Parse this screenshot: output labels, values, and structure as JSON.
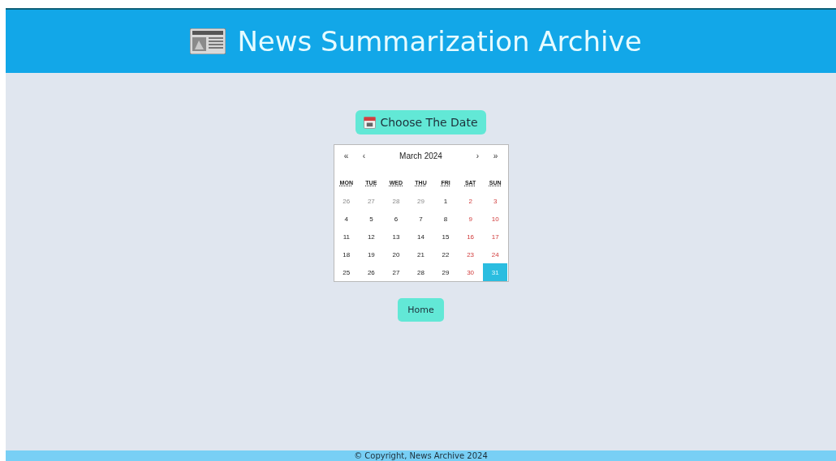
{
  "header": {
    "title": "News Summarization Archive"
  },
  "date_button": {
    "label": "Choose The Date"
  },
  "calendar": {
    "nav": [
      "«",
      "‹",
      "›",
      "»"
    ],
    "month": "March 2024",
    "weekdays": [
      "MON",
      "TUE",
      "WED",
      "THU",
      "FRI",
      "SAT",
      "SUN"
    ],
    "weeks": [
      [
        {
          "day": "26",
          "kind": "other",
          "selected": false
        },
        {
          "day": "27",
          "kind": "other",
          "selected": false
        },
        {
          "day": "28",
          "kind": "other",
          "selected": false
        },
        {
          "day": "29",
          "kind": "other",
          "selected": false
        },
        {
          "day": "1",
          "kind": "normal",
          "selected": false
        },
        {
          "day": "2",
          "kind": "weekend",
          "selected": false
        },
        {
          "day": "3",
          "kind": "weekend",
          "selected": false
        }
      ],
      [
        {
          "day": "4",
          "kind": "normal",
          "selected": false
        },
        {
          "day": "5",
          "kind": "normal",
          "selected": false
        },
        {
          "day": "6",
          "kind": "normal",
          "selected": false
        },
        {
          "day": "7",
          "kind": "normal",
          "selected": false
        },
        {
          "day": "8",
          "kind": "normal",
          "selected": false
        },
        {
          "day": "9",
          "kind": "weekend",
          "selected": false
        },
        {
          "day": "10",
          "kind": "weekend",
          "selected": false
        }
      ],
      [
        {
          "day": "11",
          "kind": "normal",
          "selected": false
        },
        {
          "day": "12",
          "kind": "normal",
          "selected": false
        },
        {
          "day": "13",
          "kind": "normal",
          "selected": false
        },
        {
          "day": "14",
          "kind": "normal",
          "selected": false
        },
        {
          "day": "15",
          "kind": "normal",
          "selected": false
        },
        {
          "day": "16",
          "kind": "weekend",
          "selected": false
        },
        {
          "day": "17",
          "kind": "weekend",
          "selected": false
        }
      ],
      [
        {
          "day": "18",
          "kind": "normal",
          "selected": false
        },
        {
          "day": "19",
          "kind": "normal",
          "selected": false
        },
        {
          "day": "20",
          "kind": "normal",
          "selected": false
        },
        {
          "day": "21",
          "kind": "normal",
          "selected": false
        },
        {
          "day": "22",
          "kind": "normal",
          "selected": false
        },
        {
          "day": "23",
          "kind": "weekend",
          "selected": false
        },
        {
          "day": "24",
          "kind": "weekend",
          "selected": false
        }
      ],
      [
        {
          "day": "25",
          "kind": "normal",
          "selected": false
        },
        {
          "day": "26",
          "kind": "normal",
          "selected": false
        },
        {
          "day": "27",
          "kind": "normal",
          "selected": false
        },
        {
          "day": "28",
          "kind": "normal",
          "selected": false
        },
        {
          "day": "29",
          "kind": "normal",
          "selected": false
        },
        {
          "day": "30",
          "kind": "weekend",
          "selected": false
        },
        {
          "day": "31",
          "kind": "weekend",
          "selected": true
        }
      ]
    ]
  },
  "home_button": {
    "label": "Home"
  },
  "footer": {
    "text": "© Copyright, News Archive 2024"
  }
}
